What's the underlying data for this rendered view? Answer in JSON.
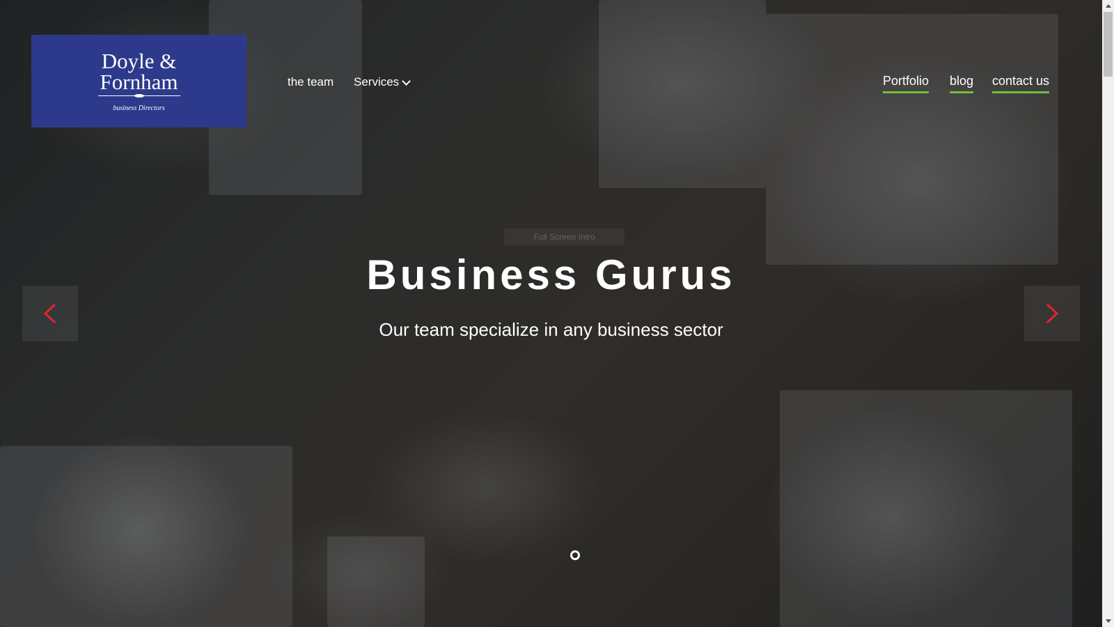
{
  "logo": {
    "line1": "Doyle &",
    "line2": "Fornham",
    "tagline": "business Directors",
    "background": "#2d3a8c"
  },
  "nav": {
    "left": [
      {
        "label": "the team"
      },
      {
        "label": "Services",
        "icon": "chevron-down-icon"
      }
    ],
    "right": [
      {
        "label": "Portfolio"
      },
      {
        "label": "blog"
      },
      {
        "label": "contact us"
      }
    ],
    "accent_underline": "#6cc33a"
  },
  "hero": {
    "hidden_label": "Full Screen Intro",
    "title": "Business Gurus",
    "subtitle": "Our team specialize in any business sector",
    "prev_icon": "chevron-left-icon",
    "next_icon": "chevron-right-icon",
    "arrow_color": "#e0262e",
    "slide_count": 1,
    "active_slide": 1
  }
}
